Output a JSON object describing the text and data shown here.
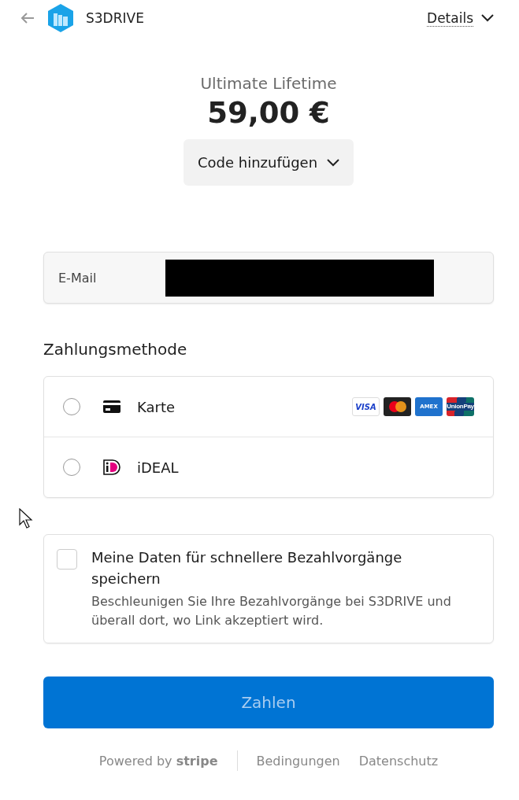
{
  "header": {
    "brand": "S3DRIVE",
    "details": "Details"
  },
  "product": {
    "name": "Ultimate Lifetime",
    "price": "59,00 €",
    "code_button": "Code hinzufügen"
  },
  "email": {
    "label": "E-Mail",
    "redacted": true
  },
  "payment": {
    "title": "Zahlungsmethode",
    "methods": [
      {
        "kind": "card",
        "label": "Karte",
        "selected": false,
        "brands": [
          {
            "kind": "visa",
            "label": "VISA"
          },
          {
            "kind": "mastercard"
          },
          {
            "kind": "amex",
            "label": "AMEX"
          },
          {
            "kind": "unionpay",
            "label": "UnionPay"
          }
        ]
      },
      {
        "kind": "ideal",
        "label": "iDEAL",
        "selected": false
      }
    ]
  },
  "save": {
    "checked": false,
    "title": "Meine Daten für schnellere Bezahlvorgänge speichern",
    "description": "Beschleunigen Sie Ihre Bezahlvorgänge bei S3DRIVE und überall dort, wo Link akzeptiert wird."
  },
  "pay_button": {
    "label": "Zahlen",
    "disabled": true
  },
  "footer": {
    "powered": "Powered by **stripe**",
    "links": [
      "Bedingungen",
      "Datenschutz"
    ]
  }
}
